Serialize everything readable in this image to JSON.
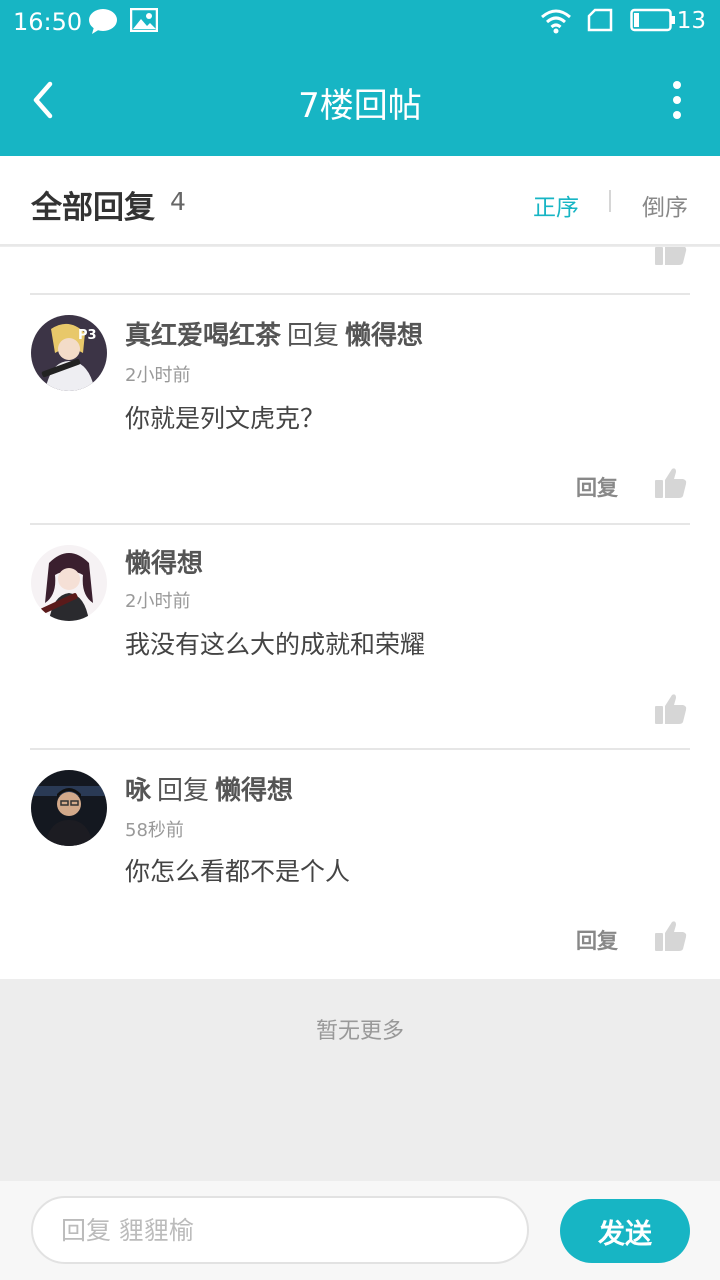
{
  "status_bar": {
    "time": "16:50",
    "icons": [
      "chat-bubble-icon",
      "image-icon",
      "wifi-icon",
      "sim-icon",
      "battery-icon"
    ],
    "battery": "13"
  },
  "app_bar": {
    "title": "7楼回帖",
    "back_icon": "back-chevron-icon",
    "more_icon": "more-vertical-icon"
  },
  "replies_header": {
    "title": "全部回复",
    "count": "4",
    "sort_asc": "正序",
    "sort_desc": "倒序"
  },
  "replies": [
    {
      "user": "真红爱喝红茶",
      "reply_word": "回复",
      "reply_to": "懒得想",
      "time": "2小时前",
      "text": "你就是列文虎克？",
      "reply_label": "回复"
    },
    {
      "user": "懒得想",
      "time": "2小时前",
      "text": "我没有这么大的成就和荣耀"
    },
    {
      "user": "咏",
      "reply_word": "回复",
      "reply_to": "懒得想",
      "time": "58秒前",
      "text": "你怎么看都不是个人",
      "reply_label": "回复"
    }
  ],
  "no_more": "暂无更多",
  "composer": {
    "placeholder": "回复 貍貍榆",
    "send_label": "发送"
  },
  "colors": {
    "accent": "#17b5c4",
    "background": "#ededed"
  }
}
